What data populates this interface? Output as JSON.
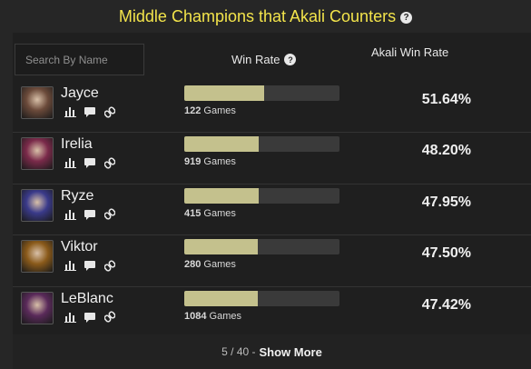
{
  "title": "Middle Champions that Akali Counters",
  "search": {
    "placeholder": "Search By Name"
  },
  "columns": {
    "win_rate": "Win Rate",
    "akali_win_rate": "Akali Win Rate"
  },
  "rows": [
    {
      "name": "Jayce",
      "games": "122",
      "games_label": "Games",
      "win_rate": 51.64,
      "akali_win_rate": "51.64%",
      "avatar_color": "#6b4a3a"
    },
    {
      "name": "Irelia",
      "games": "919",
      "games_label": "Games",
      "win_rate": 48.2,
      "akali_win_rate": "48.20%",
      "avatar_color": "#7a2a4a"
    },
    {
      "name": "Ryze",
      "games": "415",
      "games_label": "Games",
      "win_rate": 47.95,
      "akali_win_rate": "47.95%",
      "avatar_color": "#3a3a8a"
    },
    {
      "name": "Viktor",
      "games": "280",
      "games_label": "Games",
      "win_rate": 47.5,
      "akali_win_rate": "47.50%",
      "avatar_color": "#8a5a1a"
    },
    {
      "name": "LeBlanc",
      "games": "1084",
      "games_label": "Games",
      "win_rate": 47.42,
      "akali_win_rate": "47.42%",
      "avatar_color": "#5a2a5a"
    }
  ],
  "footer": {
    "count": "5 / 40 -",
    "show_more": "Show More"
  },
  "colors": {
    "title": "#f3e44b",
    "bar_fill": "#c4c18d",
    "bar_track": "#3a3a3a"
  },
  "icons": [
    "help-icon",
    "stats-icon",
    "chat-icon",
    "link-icon"
  ]
}
